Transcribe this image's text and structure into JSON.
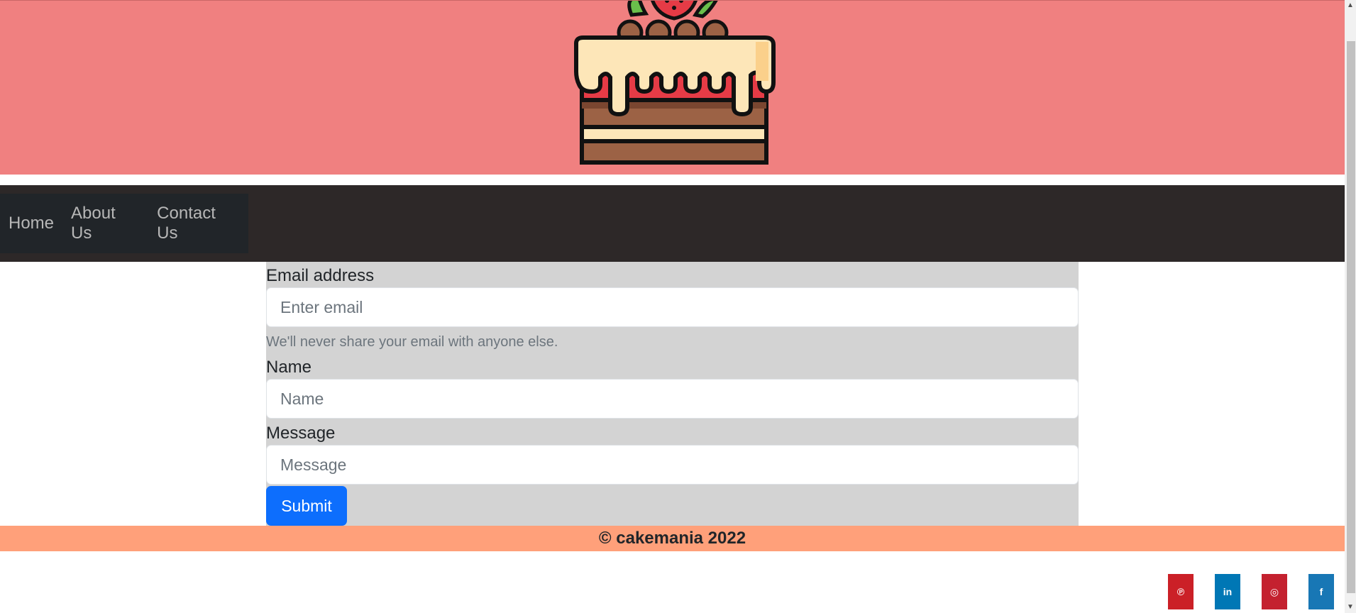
{
  "nav": {
    "items": [
      {
        "label": "Home"
      },
      {
        "label": "About Us"
      },
      {
        "label": "Contact Us"
      }
    ]
  },
  "form": {
    "email_label": "Email address",
    "email_placeholder": "Enter email",
    "email_help": "We'll never share your email with anyone else.",
    "name_label": "Name",
    "name_placeholder": "Name",
    "message_label": "Message",
    "message_placeholder": "Message",
    "submit_label": "Submit"
  },
  "footer": {
    "copyright": "© cakemania 2022"
  },
  "social": [
    {
      "icon": "pinterest-icon",
      "glyph": "℗",
      "color": "#cb2027"
    },
    {
      "icon": "linkedin-icon",
      "glyph": "in",
      "color": "#0077b5"
    },
    {
      "icon": "instagram-icon",
      "glyph": "◎",
      "color": "#c4212f"
    },
    {
      "icon": "facebook-icon",
      "glyph": "f",
      "color": "#1877b5"
    }
  ],
  "colors": {
    "header_bg": "#f08080",
    "nav_bg": "#2d2828",
    "form_bg": "#d3d3d3",
    "submit_bg": "#0d6efd",
    "footer_bg": "#ffa07a"
  }
}
